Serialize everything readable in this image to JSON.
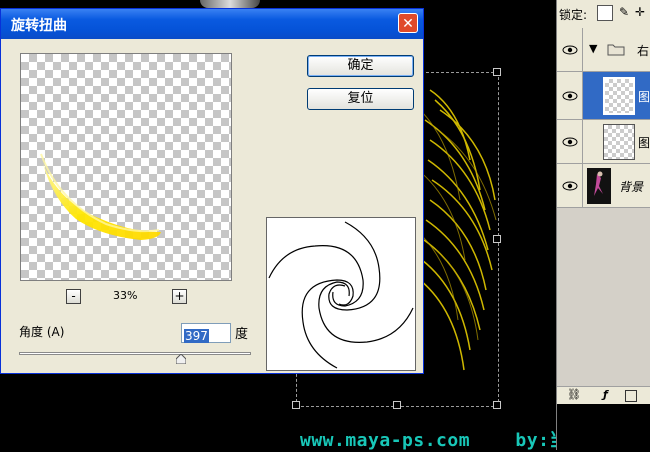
{
  "dialog": {
    "title": "旋转扭曲",
    "close_label": "✕",
    "ok_label": "确定",
    "reset_label": "复位",
    "zoom_out_label": "-",
    "zoom_in_label": "+",
    "zoom_level": "33%",
    "angle_label": "角度 (A)",
    "angle_value": "397",
    "angle_unit": "度",
    "angle_slider_fraction": 0.7
  },
  "layers_panel": {
    "lock_label": "锁定:",
    "layers": [
      {
        "name": "右",
        "type": "group"
      },
      {
        "name": "图",
        "selected": true
      },
      {
        "name": "图"
      },
      {
        "name": "背景",
        "italic": true
      }
    ]
  },
  "watermark": "www.maya-ps.com    by:当墨",
  "colors": {
    "title_bar": "#0a5ae0",
    "dialog_bg": "#ece9d8",
    "selected_layer": "#316ac5",
    "watermark": "#18c7b8",
    "streak_yellow": "#ffe600"
  }
}
